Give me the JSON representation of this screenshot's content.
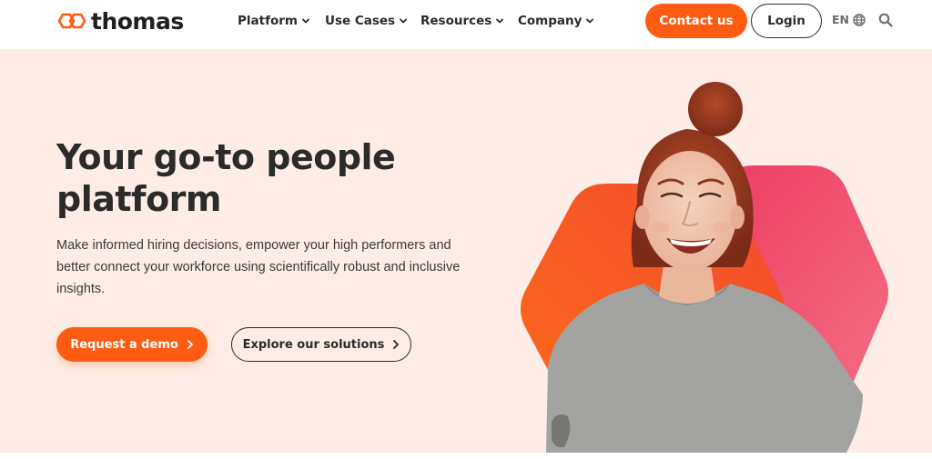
{
  "brand": {
    "name": "thomas",
    "primary_color": "#fd5c12",
    "hero_bg": "#fdede6"
  },
  "nav": {
    "items": [
      {
        "label": "Platform"
      },
      {
        "label": "Use Cases"
      },
      {
        "label": "Resources"
      },
      {
        "label": "Company"
      }
    ]
  },
  "header": {
    "contact_label": "Contact us",
    "login_label": "Login",
    "language": "EN",
    "globe_icon": "globe-icon",
    "search_icon": "search-icon"
  },
  "hero": {
    "title": "Your go-to people platform",
    "subtitle": "Make informed hiring decisions, empower your high performers and better connect your workforce using scientifically robust and inclusive insights.",
    "primary_cta": "Request a demo",
    "secondary_cta": "Explore our solutions",
    "image_alt": "Smiling woman with red hair in a bun wearing a grey t-shirt in front of orange and pink hexagon shapes"
  }
}
